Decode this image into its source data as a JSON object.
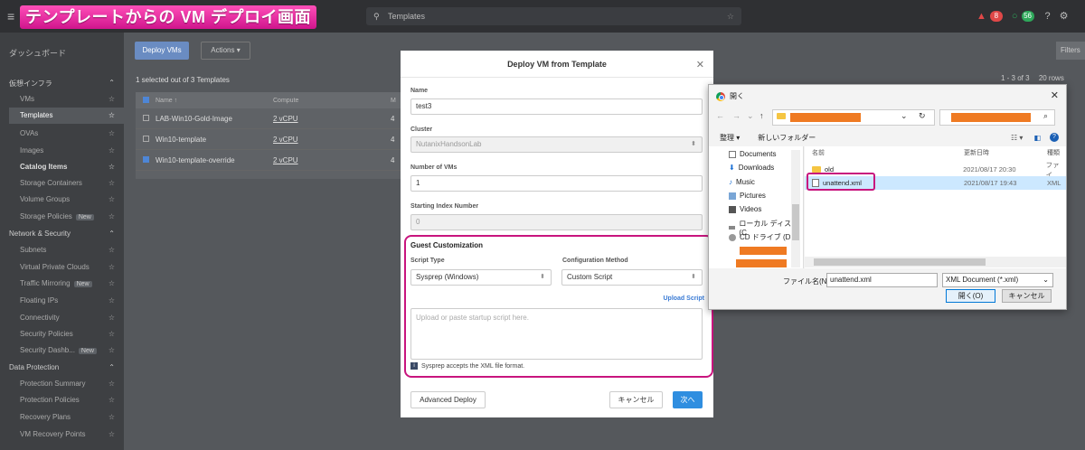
{
  "banner": "テンプレートからの VM デプロイ画面",
  "topbar": {
    "search_text": "Templates",
    "alert_count": "8",
    "status_count": "56"
  },
  "sidebar": {
    "dashboard": "ダッシュボード",
    "infra_section": "仮想インフラ",
    "infra_items": [
      "VMs",
      "Templates",
      "OVAs",
      "Images",
      "Catalog Items",
      "Storage Containers",
      "Volume Groups",
      "Storage Policies"
    ],
    "network_section": "Network & Security",
    "network_items": [
      "Subnets",
      "Virtual Private Clouds",
      "Traffic Mirroring",
      "Floating IPs",
      "Connectivity",
      "Security Policies",
      "Security Dashb..."
    ],
    "protection_section": "Data Protection",
    "protection_items": [
      "Protection Summary",
      "Protection Policies",
      "Recovery Plans",
      "VM Recovery Points"
    ],
    "new_label": "New"
  },
  "main": {
    "deploy_button": "Deploy VMs",
    "actions_button": "Actions",
    "selected_count": "1 selected out of 3 Templates",
    "filter_label": "Filters",
    "pager": "1 - 3 of 3",
    "pager_rows": "20 rows",
    "columns": [
      "Name",
      "Compute",
      "M"
    ],
    "rows": [
      {
        "name": "LAB-Win10-Gold-Image",
        "compute": "2 vCPU",
        "mem": "4"
      },
      {
        "name": "Win10-template",
        "compute": "2 vCPU",
        "mem": "4"
      },
      {
        "name": "Win10-template-override",
        "compute": "2 vCPU",
        "mem": "4"
      }
    ]
  },
  "modal": {
    "title": "Deploy VM from Template",
    "name_label": "Name",
    "name_value": "test3",
    "cluster_label": "Cluster",
    "cluster_value": "NutanixHandsonLab",
    "num_vms_label": "Number of VMs",
    "num_vms_value": "1",
    "start_index_label": "Starting Index Number",
    "start_index_value": "0",
    "guest_title": "Guest Customization",
    "script_type_label": "Script Type",
    "script_type_value": "Sysprep (Windows)",
    "config_method_label": "Configuration Method",
    "config_method_value": "Custom Script",
    "upload_link": "Upload Script",
    "script_placeholder": "Upload or paste startup script here.",
    "hint": "Sysprep accepts the XML file format.",
    "advanced_button": "Advanced Deploy",
    "cancel_button": "キャンセル",
    "next_button": "次へ"
  },
  "dialog": {
    "title": "開く",
    "organize": "整理",
    "new_folder": "新しいフォルダー",
    "col_name": "名前",
    "col_date": "更新日時",
    "col_type": "種類",
    "tree_items": [
      "Documents",
      "Downloads",
      "Music",
      "Pictures",
      "Videos",
      "ローカル ディスク (C",
      "CD ドライブ (D:)"
    ],
    "files": [
      {
        "name": "old",
        "date": "2021/08/17 20:30",
        "type": "ファイ"
      },
      {
        "name": "unattend.xml",
        "date": "2021/08/17 19:43",
        "type": "XML"
      }
    ],
    "filename_label": "ファイル名(N):",
    "filename_value": "unattend.xml",
    "filetype_value": "XML Document (*.xml)",
    "open_button": "開く(O)",
    "cancel_button": "キャンセル"
  },
  "colors": {
    "accent": "#2f8ee0",
    "highlight": "#c8157e",
    "redact": "#ef7a22"
  }
}
